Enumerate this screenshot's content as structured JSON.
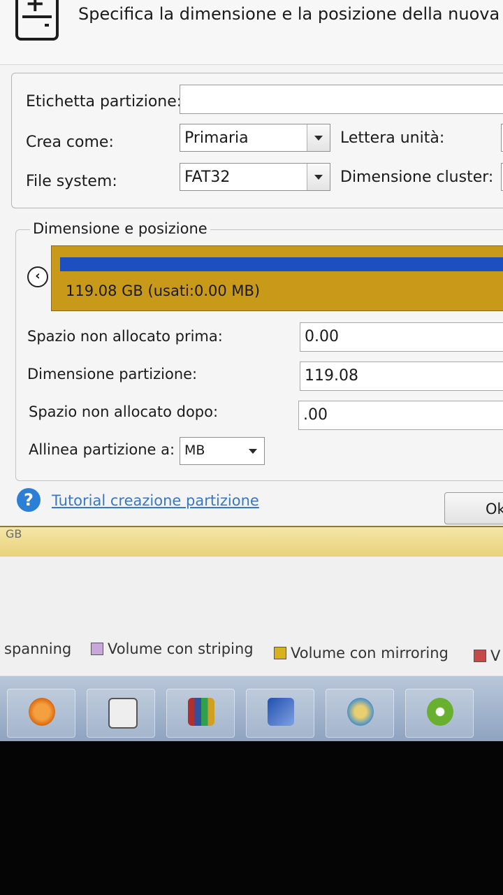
{
  "header": {
    "title": "Specifica la dimensione e la posizione della nuova partiz",
    "icon": "disk-add-icon"
  },
  "properties": {
    "label_partition": "Etichetta partizione:",
    "partition_label_value": "",
    "label_create_as": "Crea come:",
    "create_as_value": "Primaria",
    "label_drive_letter": "Lettera unità:",
    "label_file_system": "File system:",
    "file_system_value": "FAT32",
    "label_cluster_size": "Dimensione cluster:"
  },
  "size_position": {
    "legend": "Dimensione e posizione",
    "partition_info": "119.08 GB (usati:0.00 MB)",
    "unallocated_before_label": "Spazio non allocato prima:",
    "unallocated_before_value": "0.00",
    "partition_size_label": "Dimensione partizione:",
    "partition_size_value": "119.08",
    "unallocated_after_label": "Spazio non allocato dopo:",
    "unallocated_after_value": ".00",
    "align_label": "Allinea partizione a:",
    "align_value": "MB"
  },
  "footer": {
    "tutorial_link": "Tutorial creazione partizione",
    "ok_label": "Ok"
  },
  "main_window": {
    "gb_label": "GB",
    "legend": [
      {
        "label": "spanning",
        "color": ""
      },
      {
        "label": "Volume con striping",
        "color": "#c8a8d8"
      },
      {
        "label": "Volume con mirroring",
        "color": "#d8b020"
      },
      {
        "label": "V",
        "color": "#c84848"
      }
    ]
  },
  "taskbar": {
    "items": [
      "media-player-icon",
      "window-app-icon",
      "winrar-icon",
      "network-app-icon",
      "explorer-icon",
      "green-app-icon"
    ]
  },
  "colors": {
    "bar_used": "#1e4fc0",
    "bar_fill": "#c99a1a",
    "link": "#3a76c2"
  }
}
